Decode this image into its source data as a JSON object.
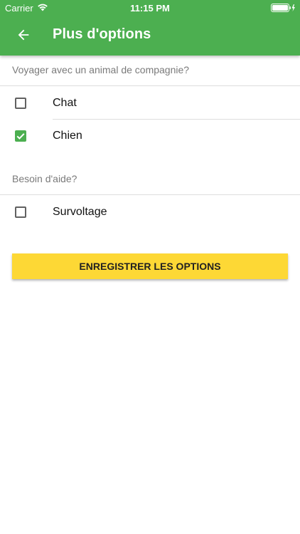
{
  "status_bar": {
    "carrier": "Carrier",
    "time": "11:15 PM",
    "wifi_icon": "wifi-icon",
    "battery_icon": "battery-icon"
  },
  "header": {
    "title": "Plus d'options",
    "back_icon": "arrow-back-icon"
  },
  "sections": [
    {
      "label": "Voyager avec un animal de compagnie?",
      "options": [
        {
          "label": "Chat",
          "checked": false
        },
        {
          "label": "Chien",
          "checked": true
        }
      ]
    },
    {
      "label": "Besoin d'aide?",
      "options": [
        {
          "label": "Survoltage",
          "checked": false
        }
      ]
    }
  ],
  "save_button": {
    "label": "ENREGISTRER LES OPTIONS"
  },
  "colors": {
    "primary": "#4caf50",
    "accent": "#fdd835",
    "section_text": "#7a7a7a",
    "divider": "#dddddd"
  }
}
